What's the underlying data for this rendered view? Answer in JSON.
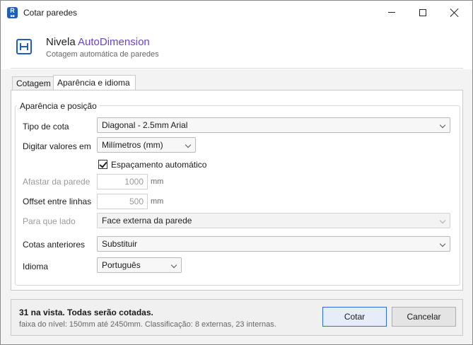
{
  "window": {
    "title": "Cotar paredes",
    "app_icon_letter": "R",
    "app_icon_sub": "■■"
  },
  "header": {
    "title_prefix": "Nivela ",
    "title_accent": "AutoDimension",
    "subtitle": "Cotagem automática de paredes",
    "accent_color": "#6a43c9",
    "icon": "dimension-icon"
  },
  "tabs": [
    {
      "label": "Cotagem",
      "active": false
    },
    {
      "label": "Aparência e idioma",
      "active": true
    }
  ],
  "group": {
    "title": "Aparência e posição",
    "fields": {
      "dim_type": {
        "label": "Tipo de cota",
        "value": "Diagonal - 2.5mm Arial"
      },
      "units": {
        "label": "Digitar valores em",
        "value": "Milímetros (mm)"
      },
      "auto_spacing": {
        "label": "Espaçamento automático",
        "checked": true
      },
      "offset_wall": {
        "label": "Afastar da parede",
        "value": "1000",
        "unit": "mm"
      },
      "offset_lines": {
        "label": "Offset entre linhas",
        "value": "500",
        "unit": "mm"
      },
      "side": {
        "label": "Para que lado",
        "value": "Face externa da parede",
        "disabled": true
      },
      "previous": {
        "label": "Cotas anteriores",
        "value": "Substituir"
      },
      "language": {
        "label": "Idioma",
        "value": "Português"
      }
    }
  },
  "footer": {
    "status": "31 na vista. Todas serão cotadas.",
    "detail": "faixa do nível: 150mm até 2450mm. Classificação: 8 externas, 23 internas.",
    "ok_label": "Cotar",
    "cancel_label": "Cancelar",
    "primary_border_color": "#2b6fd6"
  }
}
